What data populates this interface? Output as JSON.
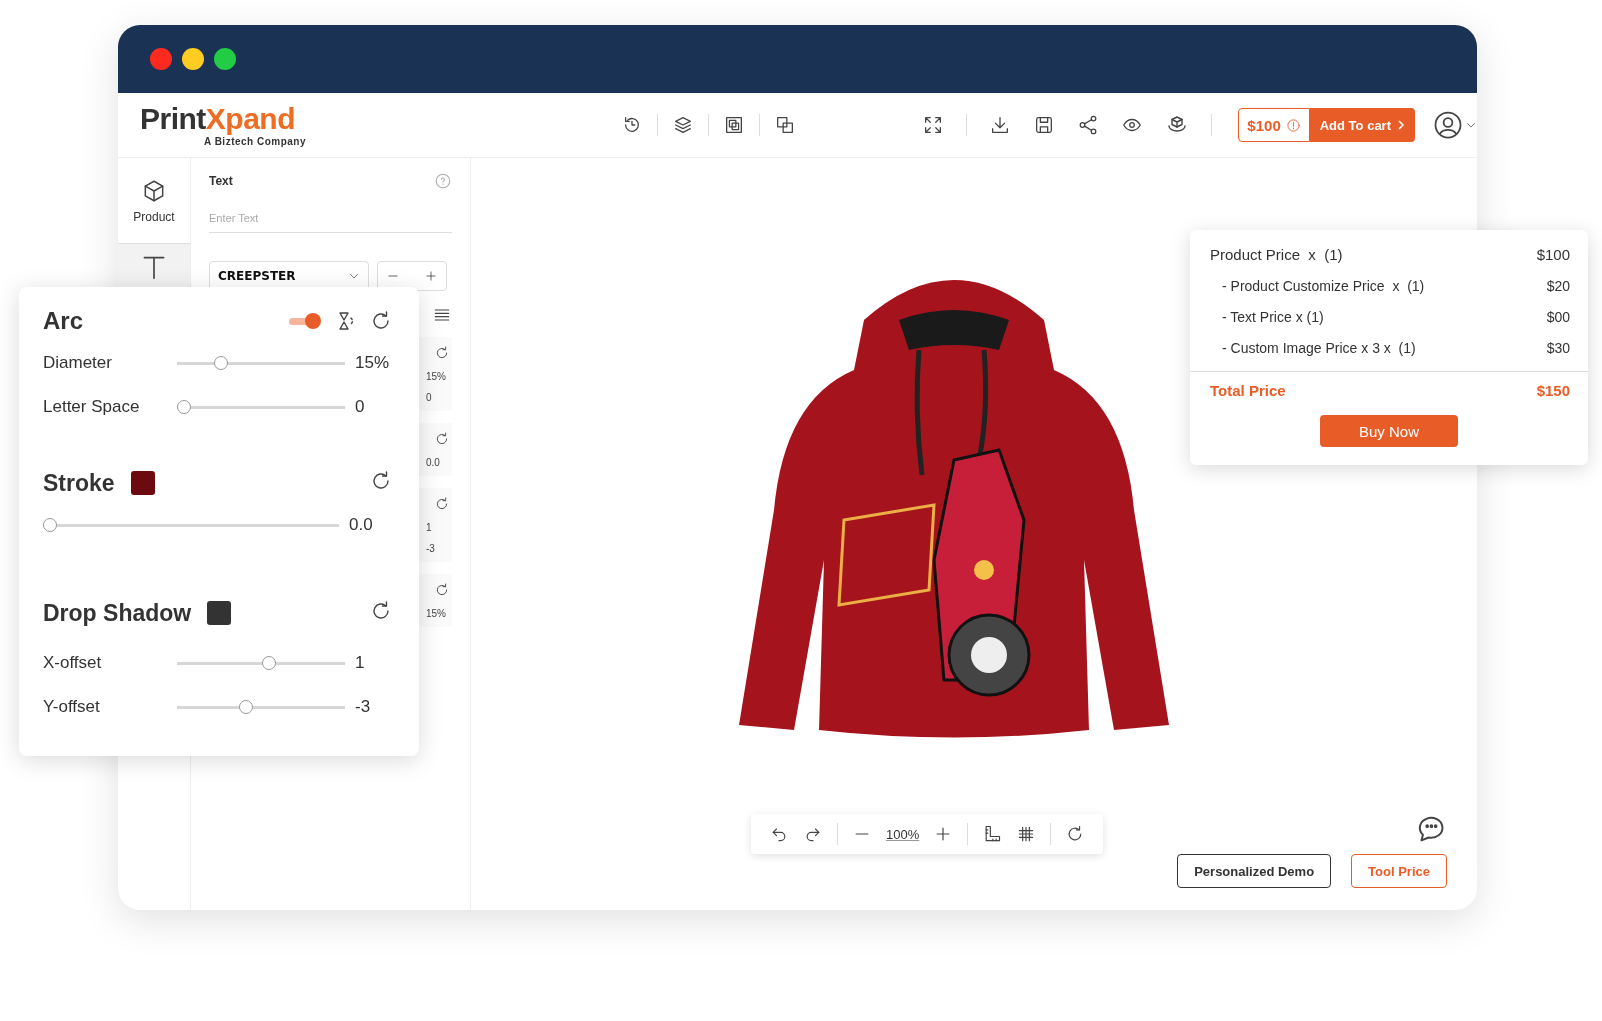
{
  "logo": {
    "name_dark": "Print",
    "name_accent": "Xpand",
    "tagline": "A Biztech Company"
  },
  "cart": {
    "price": "$100",
    "add_label": "Add To cart"
  },
  "sidebar": {
    "items": [
      {
        "kind": "product",
        "label": "Product",
        "selected": false
      },
      {
        "kind": "text",
        "selected": true
      }
    ]
  },
  "text_panel": {
    "title": "Text",
    "placeholder": "Enter Text",
    "font": "CREEPSTER",
    "hidden_sections": [
      {
        "values": [
          "15%",
          "0"
        ]
      },
      {
        "values": [
          "0.0"
        ]
      },
      {
        "values": [
          "1",
          "-3"
        ]
      },
      {
        "values": [
          "15%"
        ]
      }
    ]
  },
  "arc_panel": {
    "title": "Arc",
    "enabled": true,
    "sliders": [
      {
        "label": "Diameter",
        "level": 0.24,
        "reading": "15%"
      },
      {
        "label": "Letter Space",
        "level": 0,
        "reading": "0"
      }
    ]
  },
  "stroke": {
    "title": "Stroke",
    "color": "#6b0a0f",
    "level": 0,
    "reading": "0.0"
  },
  "drop_shadow": {
    "title": "Drop Shadow",
    "color": "#333333",
    "sliders": [
      {
        "label": "X-offset",
        "level": 0.55,
        "reading": "1"
      },
      {
        "label": "Y-offset",
        "level": 0.4,
        "reading": "-3"
      }
    ]
  },
  "price_card": {
    "lines": [
      {
        "kind": "main",
        "label": "Product Price  x  (1)",
        "amount": "$100"
      },
      {
        "kind": "sub",
        "label": "- Product Customize Price  x  (1)",
        "amount": "$20"
      },
      {
        "kind": "sub",
        "label": "- Text Price x (1)",
        "amount": "$00"
      },
      {
        "kind": "sub",
        "label": "- Custom Image Price x 3 x  (1)",
        "amount": "$30"
      }
    ],
    "total_label": "Total Price",
    "total": "$150",
    "button": "Buy Now"
  },
  "zoom_bar": {
    "zoom": "100%"
  },
  "buttons": [
    {
      "kind": "outline",
      "label": "Personalized Demo"
    },
    {
      "kind": "accent",
      "label": "Tool Price"
    }
  ]
}
